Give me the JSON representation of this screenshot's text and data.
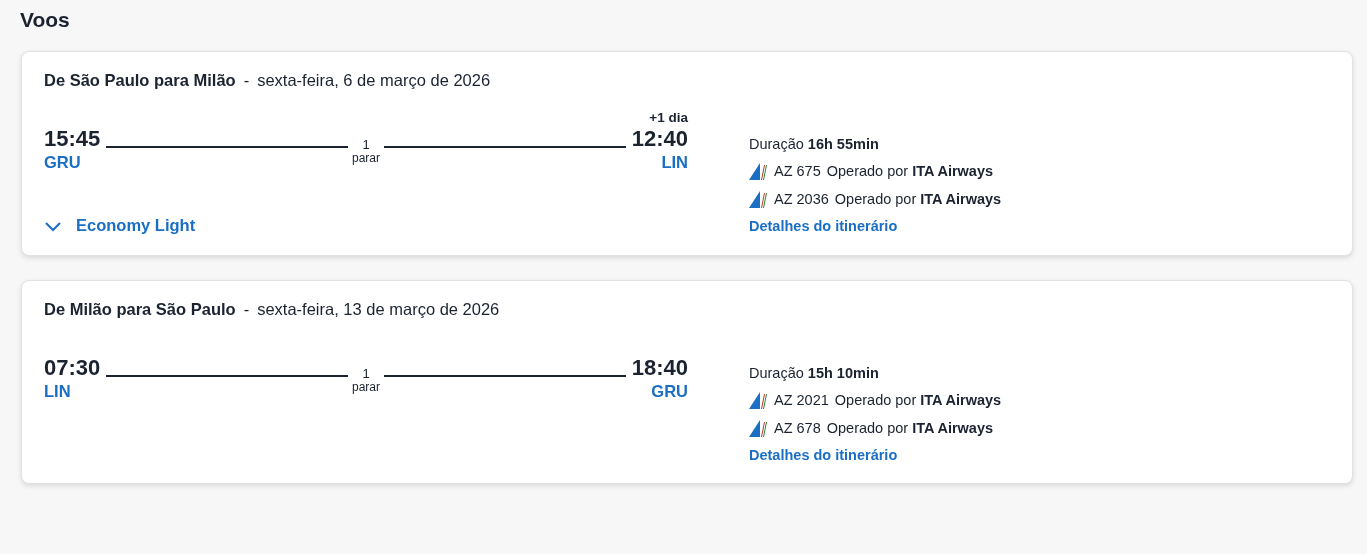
{
  "title": "Voos",
  "flights": [
    {
      "route": "De São Paulo para Milão",
      "separator": "-",
      "date": "sexta-feira, 6 de março de 2026",
      "departure": {
        "time": "15:45",
        "airport": "GRU"
      },
      "arrival": {
        "time": "12:40",
        "airport": "LIN",
        "day_offset": "+1 dia"
      },
      "stops": {
        "count": "1",
        "label": "parar"
      },
      "duration": "Duração **16h 55min**",
      "segments": [
        {
          "flight": "AZ 675",
          "operator": "Operado por **ITA Airways**"
        },
        {
          "flight": "AZ 2036",
          "operator": "Operado por **ITA Airways**"
        }
      ],
      "details_link": "Detalhes do itinerário",
      "fare": {
        "label": "Economy Light",
        "expanded": false
      }
    },
    {
      "route": "De Milão para São Paulo",
      "separator": "-",
      "date": "sexta-feira, 13 de março de 2026",
      "departure": {
        "time": "07:30",
        "airport": "LIN"
      },
      "arrival": {
        "time": "18:40",
        "airport": "GRU"
      },
      "stops": {
        "count": "1",
        "label": "parar"
      },
      "duration": "Duração **15h 10min**",
      "segments": [
        {
          "flight": "AZ 2021",
          "operator": "Operado por **ITA Airways**"
        },
        {
          "flight": "AZ 678",
          "operator": "Operado por **ITA Airways**"
        }
      ],
      "details_link": "Detalhes do itinerário"
    }
  ]
}
